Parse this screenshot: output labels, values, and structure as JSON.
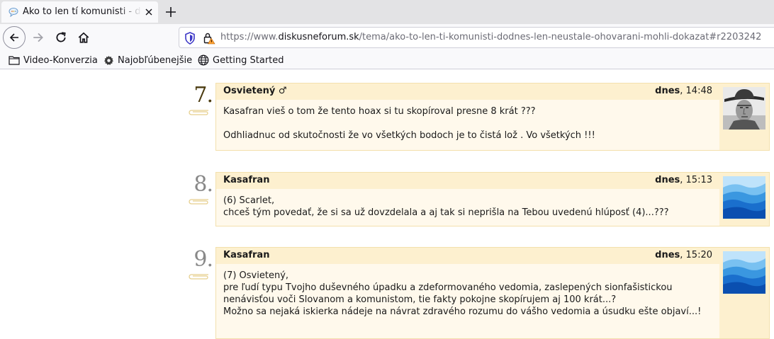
{
  "browser": {
    "tab_title": "Ako to len tí komunisti - diskusneforum.sk",
    "url_prefix": "https://www.",
    "url_host": "diskusneforum.sk",
    "url_path": "/tema/ako-to-len-ti-komunisti-dodnes-len-neustale-ohovarani-mohli-dokazat#r2203242",
    "bookmarks": [
      "Video-Konverzia",
      "Najobľúbenejšie",
      "Getting Started"
    ]
  },
  "posts": [
    {
      "number": "7.",
      "author": "Osvietený",
      "sex_symbol": "♂",
      "date_day": "dnes",
      "date_time": ", 14:48",
      "avatar": "cowboy-portrait",
      "paragraphs": [
        "Kasafran vieš o tom že tento hoax si tu skopíroval presne 8 krát ???",
        "Odhliadnuc od skutočnosti že vo všetkých bodoch je to čistá lož . Vo všetkých !!!"
      ]
    },
    {
      "number": "8.",
      "author": "Kasafran",
      "sex_symbol": "",
      "date_day": "dnes",
      "date_time": ", 15:13",
      "avatar": "blue-mountains",
      "paragraphs": [
        "(6) Scarlet,\nchceš tým povedať, že si sa už dovzdelala a aj tak si neprišla na Tebou uvedenú hlúposť (4)...???"
      ]
    },
    {
      "number": "9.",
      "author": "Kasafran",
      "sex_symbol": "",
      "date_day": "dnes",
      "date_time": ", 15:20",
      "avatar": "blue-mountains",
      "paragraphs": [
        "(7) Osvietený,\npre ľudí typu Tvojho duševného úpadku a zdeformovaného vedomia, zaslepených sionfašistickou nenávisťou voči Slovanom a komunistom, tie fakty pokojne skopírujem aj 100 krát...?\nMožno sa nejaká iskierka nádeje na návrat zdravého rozumu do vášho vedomia a úsudku ešte objaví...!"
      ]
    }
  ]
}
